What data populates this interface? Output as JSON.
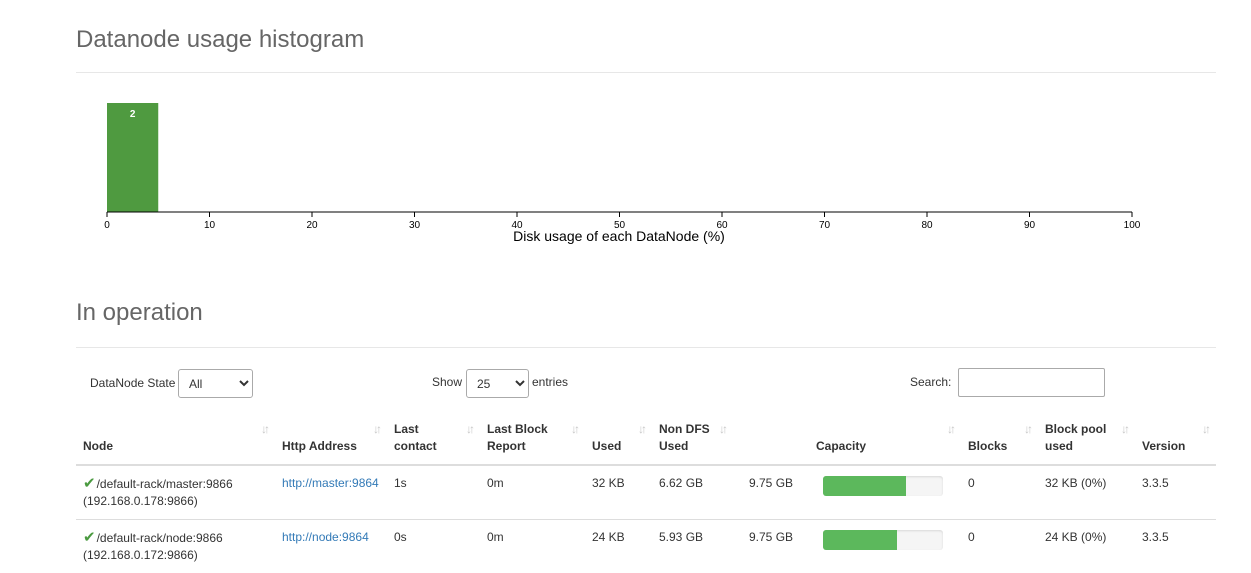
{
  "histogram": {
    "title": "Datanode usage histogram",
    "chart_data": {
      "type": "bar",
      "bins": [
        {
          "from": 0,
          "to": 5,
          "count": 2
        }
      ],
      "xlabel": "Disk usage of each DataNode (%)",
      "xlim": [
        0,
        100
      ],
      "xticks": [
        "0",
        "10",
        "20",
        "30",
        "40",
        "50",
        "60",
        "70",
        "80",
        "90",
        "100"
      ],
      "colors": {
        "bar": "#4f9a40",
        "bar_label": "#ffffff",
        "axis": "#000000"
      }
    }
  },
  "operation": {
    "title": "In operation",
    "state_filter": {
      "label": "DataNode State",
      "selected": "All"
    },
    "length": {
      "show_label": "Show",
      "selected": "25",
      "entries_label": "entries"
    },
    "search": {
      "label": "Search:",
      "value": ""
    },
    "columns": [
      {
        "key": "node",
        "label": "Node"
      },
      {
        "key": "http",
        "label": "Http Address"
      },
      {
        "key": "last_contact",
        "label": "Last contact"
      },
      {
        "key": "last_block",
        "label": "Last Block Report"
      },
      {
        "key": "used",
        "label": "Used"
      },
      {
        "key": "non_dfs",
        "label": "Non DFS Used"
      },
      {
        "key": "capacity",
        "label": "Capacity"
      },
      {
        "key": "blocks",
        "label": "Blocks"
      },
      {
        "key": "pool",
        "label": "Block pool used"
      },
      {
        "key": "version",
        "label": "Version"
      }
    ],
    "rows": [
      {
        "node": "/default-rack/master:9866",
        "node_ip": "(192.168.0.178:9866)",
        "http": "http://master:9864",
        "last_contact": "1s",
        "last_block": "0m",
        "used": "32 KB",
        "non_dfs": "6.62 GB",
        "capacity": "9.75 GB",
        "capacity_fill": 0.69,
        "blocks": "0",
        "pool": "32 KB (0%)",
        "version": "3.3.5"
      },
      {
        "node": "/default-rack/node:9866",
        "node_ip": "(192.168.0.172:9866)",
        "http": "http://node:9864",
        "last_contact": "0s",
        "last_block": "0m",
        "used": "24 KB",
        "non_dfs": "5.93 GB",
        "capacity": "9.75 GB",
        "capacity_fill": 0.62,
        "blocks": "0",
        "pool": "24 KB (0%)",
        "version": "3.3.5"
      }
    ],
    "colors": {
      "capacity_fill": "#5cb85c",
      "node_check": "#4b9a40",
      "link": "#337ab7"
    }
  }
}
